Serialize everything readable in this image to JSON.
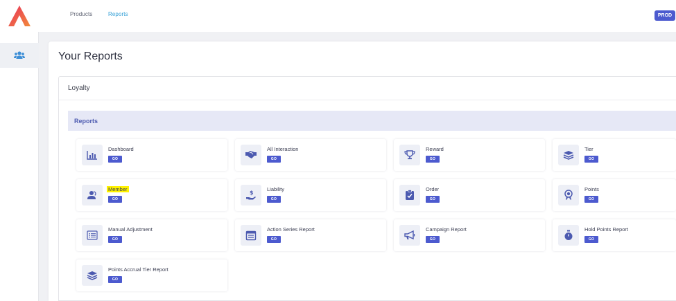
{
  "header": {
    "nav": [
      {
        "label": "Products"
      },
      {
        "label": "Reports"
      }
    ],
    "env_badge": "PROD",
    "active_color": "#2f9ed6",
    "accent_color": "#4c5acf"
  },
  "sidebar": {
    "items": [
      {
        "icon": "users-icon"
      }
    ]
  },
  "page": {
    "title": "Your Reports",
    "section_title": "Loyalty",
    "group_title": "Reports"
  },
  "reports": [
    {
      "label": "Dashboard",
      "go": "GO",
      "icon": "bar-chart-icon"
    },
    {
      "label": "All Interaction",
      "go": "GO",
      "icon": "handshake-icon"
    },
    {
      "label": "Reward",
      "go": "GO",
      "icon": "trophy-icon"
    },
    {
      "label": "Tier",
      "go": "GO",
      "icon": "layers-icon"
    },
    {
      "label": "Member",
      "go": "GO",
      "icon": "member-icon",
      "highlighted": true
    },
    {
      "label": "Liability",
      "go": "GO",
      "icon": "hand-dollar-icon"
    },
    {
      "label": "Order",
      "go": "GO",
      "icon": "clipboard-check-icon"
    },
    {
      "label": "Points",
      "go": "GO",
      "icon": "medal-icon"
    },
    {
      "label": "Manual Adjustment",
      "go": "GO",
      "icon": "list-icon"
    },
    {
      "label": "Action Series Report",
      "go": "GO",
      "icon": "calendar-icon"
    },
    {
      "label": "Campaign Report",
      "go": "GO",
      "icon": "megaphone-icon"
    },
    {
      "label": "Hold Points Report",
      "go": "GO",
      "icon": "stopwatch-icon"
    },
    {
      "label": "Points Accrual Tier Report",
      "go": "GO",
      "icon": "layers-icon"
    }
  ]
}
